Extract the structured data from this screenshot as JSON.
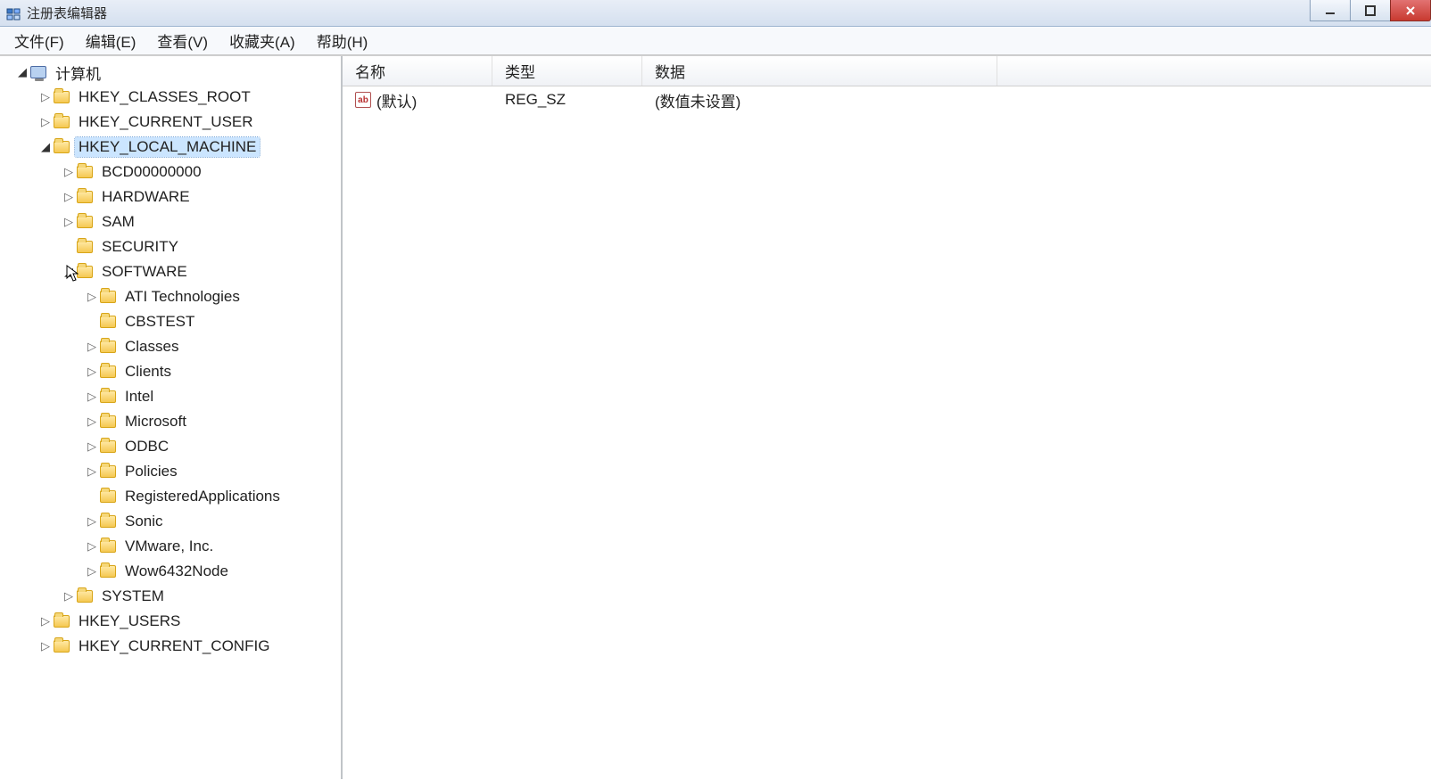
{
  "window": {
    "title": "注册表编辑器"
  },
  "menus": [
    "文件(F)",
    "编辑(E)",
    "查看(V)",
    "收藏夹(A)",
    "帮助(H)"
  ],
  "columns": {
    "name": "名称",
    "type": "类型",
    "data": "数据"
  },
  "rows": [
    {
      "name": "(默认)",
      "type": "REG_SZ",
      "data": "(数值未设置)"
    }
  ],
  "tree": {
    "root": {
      "label": "计算机",
      "expanded": true,
      "icon": "computer",
      "indent": 0
    },
    "nodes": [
      {
        "label": "HKEY_CLASSES_ROOT",
        "expandable": true,
        "indent": 1
      },
      {
        "label": "HKEY_CURRENT_USER",
        "expandable": true,
        "indent": 1
      },
      {
        "label": "HKEY_LOCAL_MACHINE",
        "expandable": true,
        "expanded": true,
        "selected": true,
        "indent": 1
      },
      {
        "label": "BCD00000000",
        "expandable": true,
        "indent": 2
      },
      {
        "label": "HARDWARE",
        "expandable": true,
        "indent": 2
      },
      {
        "label": "SAM",
        "expandable": true,
        "indent": 2
      },
      {
        "label": "SECURITY",
        "expandable": false,
        "indent": 2
      },
      {
        "label": "SOFTWARE",
        "expandable": true,
        "expanded": true,
        "indent": 2
      },
      {
        "label": "ATI Technologies",
        "expandable": true,
        "indent": 3
      },
      {
        "label": "CBSTEST",
        "expandable": false,
        "indent": 3
      },
      {
        "label": "Classes",
        "expandable": true,
        "indent": 3
      },
      {
        "label": "Clients",
        "expandable": true,
        "indent": 3
      },
      {
        "label": "Intel",
        "expandable": true,
        "indent": 3
      },
      {
        "label": "Microsoft",
        "expandable": true,
        "indent": 3
      },
      {
        "label": "ODBC",
        "expandable": true,
        "indent": 3
      },
      {
        "label": "Policies",
        "expandable": true,
        "indent": 3
      },
      {
        "label": "RegisteredApplications",
        "expandable": false,
        "indent": 3
      },
      {
        "label": "Sonic",
        "expandable": true,
        "indent": 3
      },
      {
        "label": "VMware, Inc.",
        "expandable": true,
        "indent": 3
      },
      {
        "label": "Wow6432Node",
        "expandable": true,
        "indent": 3
      },
      {
        "label": "SYSTEM",
        "expandable": true,
        "indent": 2
      },
      {
        "label": "HKEY_USERS",
        "expandable": true,
        "indent": 1
      },
      {
        "label": "HKEY_CURRENT_CONFIG",
        "expandable": true,
        "indent": 1
      }
    ]
  }
}
